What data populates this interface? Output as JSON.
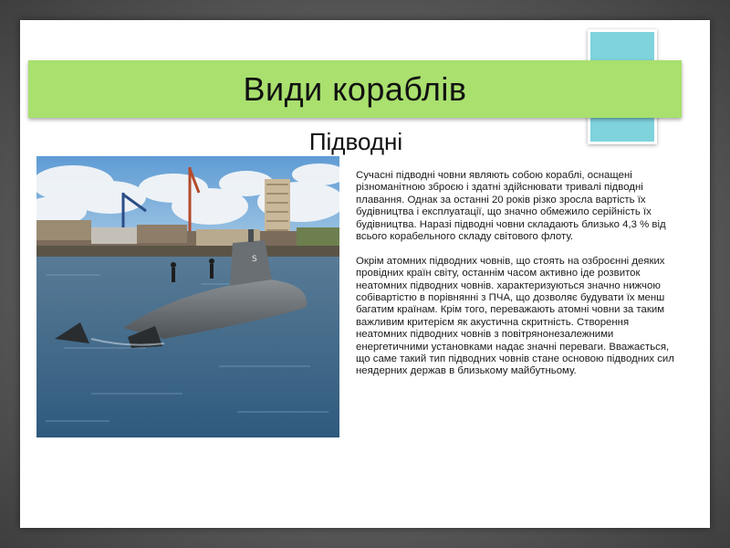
{
  "slide": {
    "title": "Види кораблів",
    "subtitle": "Підводні",
    "paragraphs": [
      "Сучасні підводні човни являють собою кораблі, оснащені різноманітною зброєю і здатні здійснювати тривалі підводні плавання. Однак за останні 20 років різко зросла вартість їх будівництва і експлуатації, що значно обмежило серійність їх будівництва. Наразі підводні човни складають близько 4,3 % від всього корабельного складу світового флоту.",
      "Окрім атомних підводних човнів, що стоять на озброєнні деяких провідних країн світу, останнім часом активно іде розвиток неатомних підводних човнів.  характеризуються значно нижчою собівартістю в порівнянні з ПЧА, що дозволяє будувати їх менш багатим країнам. Крім того,  переважають атомні човни за таким важливим критерієм як акустична скритність. Створення неатомних підводних човнів з повітрянонезалежними енергетичними установками надає значні переваги. Вважається, що саме такий тип підводних човнів стане основою підводних сил неядерних держав в близькому майбутньому."
    ],
    "colors": {
      "title_bar": "#a9e06e",
      "accent_square": "#7fd3dd",
      "water": "#3d6a8e",
      "sky": "#7fb1dc",
      "hull": "#6f7478"
    },
    "photo_icon": "submarine-photo"
  }
}
